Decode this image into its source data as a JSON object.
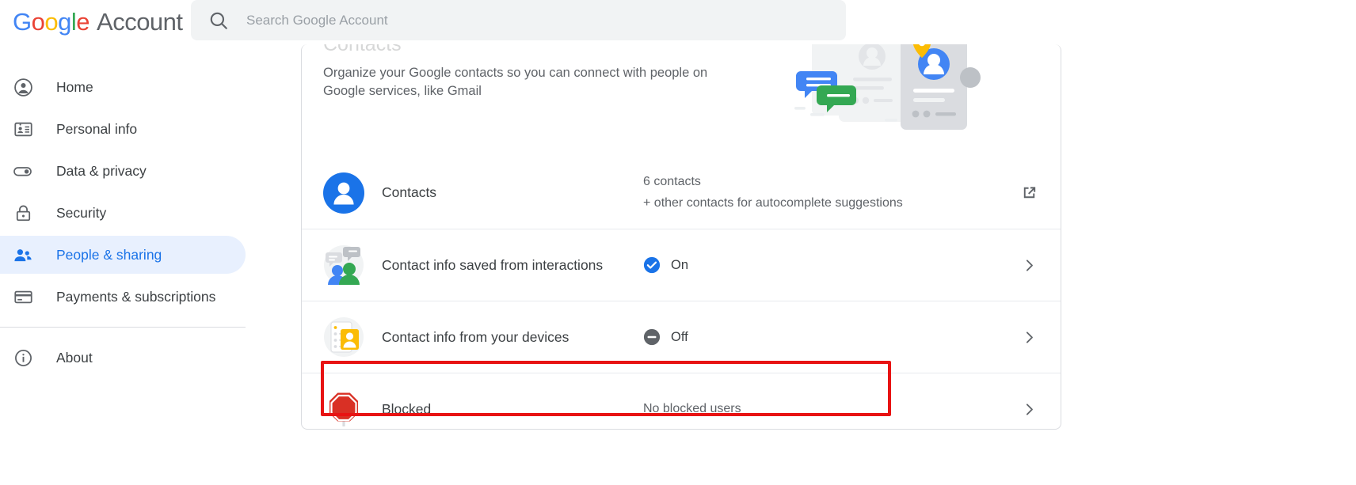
{
  "header": {
    "brand_google": "Google",
    "brand_account": "Account",
    "search_placeholder": "Search Google Account",
    "search_value": "",
    "search_icon": "search-icon"
  },
  "sidebar": {
    "items": [
      {
        "label": "Home",
        "icon": "account-circle-icon",
        "active": false
      },
      {
        "label": "Personal info",
        "icon": "contact-card-icon",
        "active": false
      },
      {
        "label": "Data & privacy",
        "icon": "toggle-switch-icon",
        "active": false
      },
      {
        "label": "Security",
        "icon": "lock-icon",
        "active": false
      },
      {
        "label": "People & sharing",
        "icon": "people-icon",
        "active": true
      },
      {
        "label": "Payments & subscriptions",
        "icon": "credit-card-icon",
        "active": false
      }
    ],
    "footer_items": [
      {
        "label": "About",
        "icon": "info-icon",
        "active": false
      }
    ]
  },
  "main": {
    "section_title": "Contacts",
    "section_description": "Organize your Google contacts so you can connect with people on Google services, like Gmail",
    "illustration": "contacts-illustration",
    "rows": [
      {
        "label": "Contacts",
        "icon": "blue-person-avatar-icon",
        "value_line1": "6 contacts",
        "value_line2": "+ other contacts for autocomplete suggestions",
        "action_icon": "open-in-new-icon",
        "status": "",
        "status_icon": ""
      },
      {
        "label": "Contact info saved from interactions",
        "icon": "people-chat-icon",
        "status": "On",
        "status_icon": "check-circle-icon",
        "action_icon": "chevron-right-icon"
      },
      {
        "label": "Contact info from your devices",
        "icon": "device-contact-card-icon",
        "status": "Off",
        "status_icon": "minus-circle-icon",
        "action_icon": "chevron-right-icon"
      },
      {
        "label": "Blocked",
        "icon": "stop-sign-icon",
        "value_line1": "No blocked users",
        "status": "",
        "status_icon": "",
        "action_icon": "chevron-right-icon"
      }
    ]
  },
  "annotation": {
    "highlight_color": "#e81313",
    "target": "Blocked"
  },
  "colors": {
    "google_blue": "#4285F4",
    "google_red": "#EA4335",
    "google_yellow": "#FBBC05",
    "google_green": "#34A853",
    "accent_blue": "#1a73e8",
    "active_pill": "#e8f0fe",
    "text_primary": "#3c4043",
    "text_secondary": "#5f6368"
  }
}
